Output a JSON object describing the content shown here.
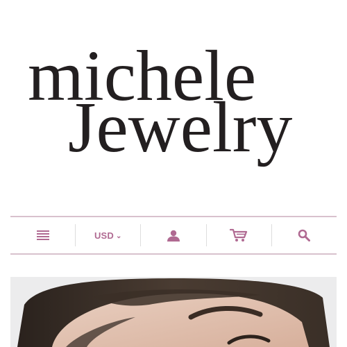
{
  "brand": {
    "line1": "michele",
    "line2": "Jewelry"
  },
  "colors": {
    "accent": "#b06a92",
    "divider": "#d8c1cd",
    "logo": "#231f20"
  },
  "nav": {
    "menu_icon": "hamburger-menu-icon",
    "currency_label": "USD",
    "currency_caret": "⌄",
    "account_icon": "user-icon",
    "cart_icon": "shopping-cart-icon",
    "search_icon": "search-icon"
  },
  "hero": {
    "image": "woman-portrait-photo"
  }
}
